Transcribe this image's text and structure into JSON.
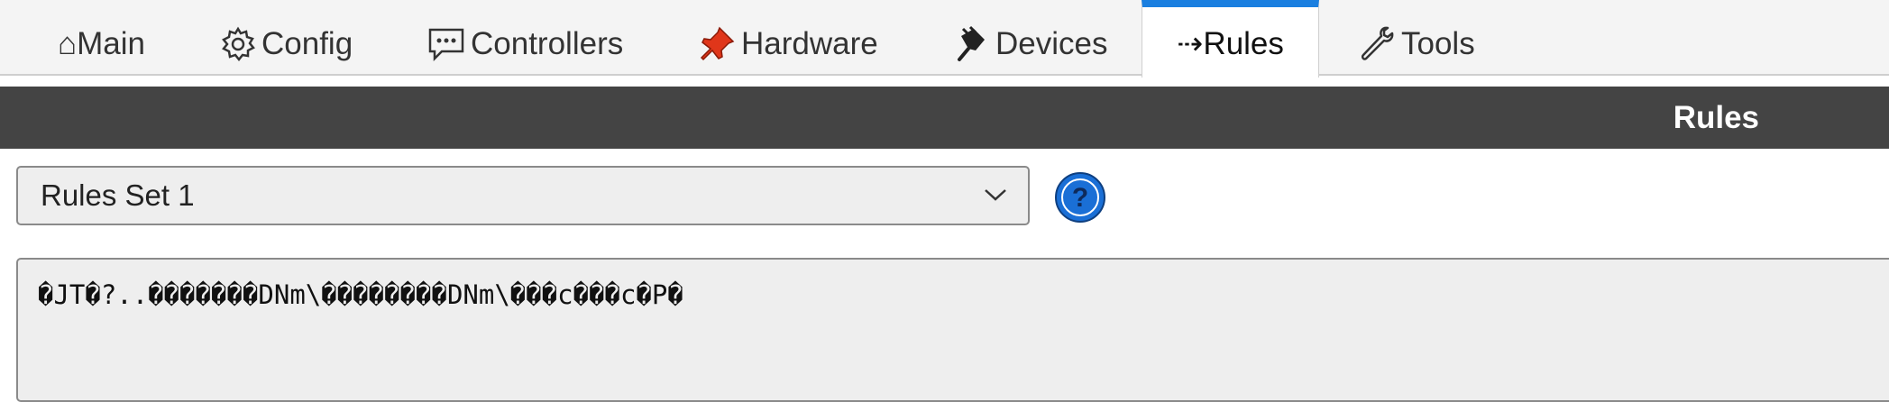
{
  "tabs": [
    {
      "id": "main",
      "label": "⌂Main",
      "icon": "home-icon"
    },
    {
      "id": "config",
      "label": "Config",
      "icon": "gear-icon"
    },
    {
      "id": "controllers",
      "label": "Controllers",
      "icon": "chat-bubble-icon"
    },
    {
      "id": "hardware",
      "label": "Hardware",
      "icon": "pushpin-icon"
    },
    {
      "id": "devices",
      "label": "Devices",
      "icon": "plug-icon"
    },
    {
      "id": "rules",
      "label": "⇢Rules",
      "icon": "arrow-icon",
      "active": true
    },
    {
      "id": "tools",
      "label": "Tools",
      "icon": "wrench-icon"
    }
  ],
  "header": {
    "title": "Rules"
  },
  "rules_select": {
    "value": "Rules Set 1"
  },
  "help": {
    "label": "?"
  },
  "editor": {
    "content": "�JT�?..�������DNm\\��������DNm\\���c���c�P�"
  },
  "colors": {
    "accent": "#1a7fe0",
    "header_bg": "#444444",
    "help": "#1a6fd6"
  }
}
